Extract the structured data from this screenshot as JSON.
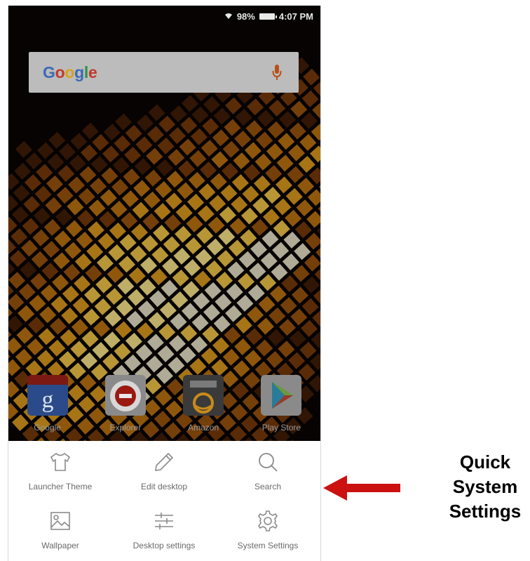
{
  "status_bar": {
    "battery_pct": "98%",
    "time": "4:07 PM"
  },
  "search": {
    "brand": "Google"
  },
  "dock": [
    {
      "label": "Google",
      "icon": "google-app-icon"
    },
    {
      "label": "Explorer",
      "icon": "browser-app-icon"
    },
    {
      "label": "Amazon",
      "icon": "amazon-app-icon"
    },
    {
      "label": "Play Store",
      "icon": "play-store-app-icon"
    }
  ],
  "quick_settings": [
    {
      "label": "Launcher Theme",
      "icon": "shirt-icon"
    },
    {
      "label": "Edit desktop",
      "icon": "pencil-icon"
    },
    {
      "label": "Search",
      "icon": "search-icon"
    },
    {
      "label": "Wallpaper",
      "icon": "image-icon"
    },
    {
      "label": "Desktop settings",
      "icon": "sliders-icon"
    },
    {
      "label": "System Settings",
      "icon": "gear-icon"
    }
  ],
  "annotation": {
    "line1": "Quick",
    "line2": "System",
    "line3": "Settings"
  },
  "colors": {
    "arrow": "#cc1111",
    "panel_text": "#6a6a6a",
    "search_bg": "#bcbcbc"
  }
}
